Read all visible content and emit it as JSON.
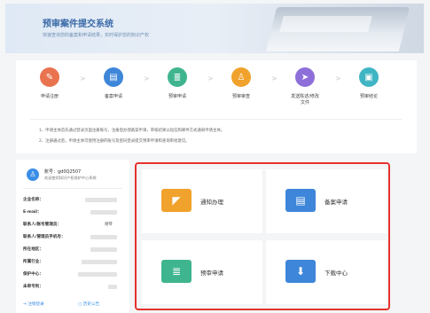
{
  "banner": {
    "title": "预审案件提交系统",
    "subtitle": "快速查询您的备案和申请结果，实时保护您的知识产权"
  },
  "steps": [
    {
      "label": "申请注册",
      "icon": "register-icon",
      "glyph": "✎",
      "color": "#e9734f"
    },
    {
      "label": "备案申请",
      "icon": "folder-icon",
      "glyph": "▤",
      "color": "#3d86d9"
    },
    {
      "label": "预审申请",
      "icon": "document-icon",
      "glyph": "≣",
      "color": "#3fb58f"
    },
    {
      "label": "预审审查",
      "icon": "reviewer-icon",
      "glyph": "♙",
      "color": "#f0a22c"
    },
    {
      "label": "发送陈述/修改\n文件",
      "icon": "send-icon",
      "glyph": "➤",
      "color": "#8e6fd9"
    },
    {
      "label": "预审结论",
      "icon": "conclusion-icon",
      "glyph": "▣",
      "color": "#3fb5c4"
    }
  ],
  "notes": [
    "1、申请主体首先通过登录页面注册账号，注册后办理备案申请，审核结果以短信和邮件方式通知申请主体。",
    "2、注册通过后，申请主体可使用注册的账号及密码登录提交预审申请和查询审批意见。"
  ],
  "user": {
    "account": "账号：gd0Q2507",
    "welcome": "欢迎使用知识产权保护中心系统"
  },
  "fields": [
    {
      "label": "企业名称：",
      "value": ""
    },
    {
      "label": "E-mail：",
      "value": ""
    },
    {
      "label": "联系人/账号管理员：",
      "value": "谢琴"
    },
    {
      "label": "联系人/管理员手机号：",
      "value": ""
    },
    {
      "label": "所在地区：",
      "value": ""
    },
    {
      "label": "所属行业：",
      "value": ""
    },
    {
      "label": "保护中心：",
      "value": ""
    },
    {
      "label": "未审专利：",
      "value": ""
    }
  ],
  "footer": {
    "logout": "注销登录",
    "notice": "历史公告"
  },
  "services": [
    {
      "label": "通知办理",
      "icon": "megaphone-icon",
      "glyph": "📢",
      "color": "#f0a22c"
    },
    {
      "label": "备案申请",
      "icon": "folder-icon",
      "glyph": "▤",
      "color": "#3d86d9"
    },
    {
      "label": "预审申请",
      "icon": "document-icon",
      "glyph": "≣",
      "color": "#3fb58f"
    },
    {
      "label": "下载中心",
      "icon": "download-icon",
      "glyph": "⬇",
      "color": "#3d86d9"
    }
  ]
}
